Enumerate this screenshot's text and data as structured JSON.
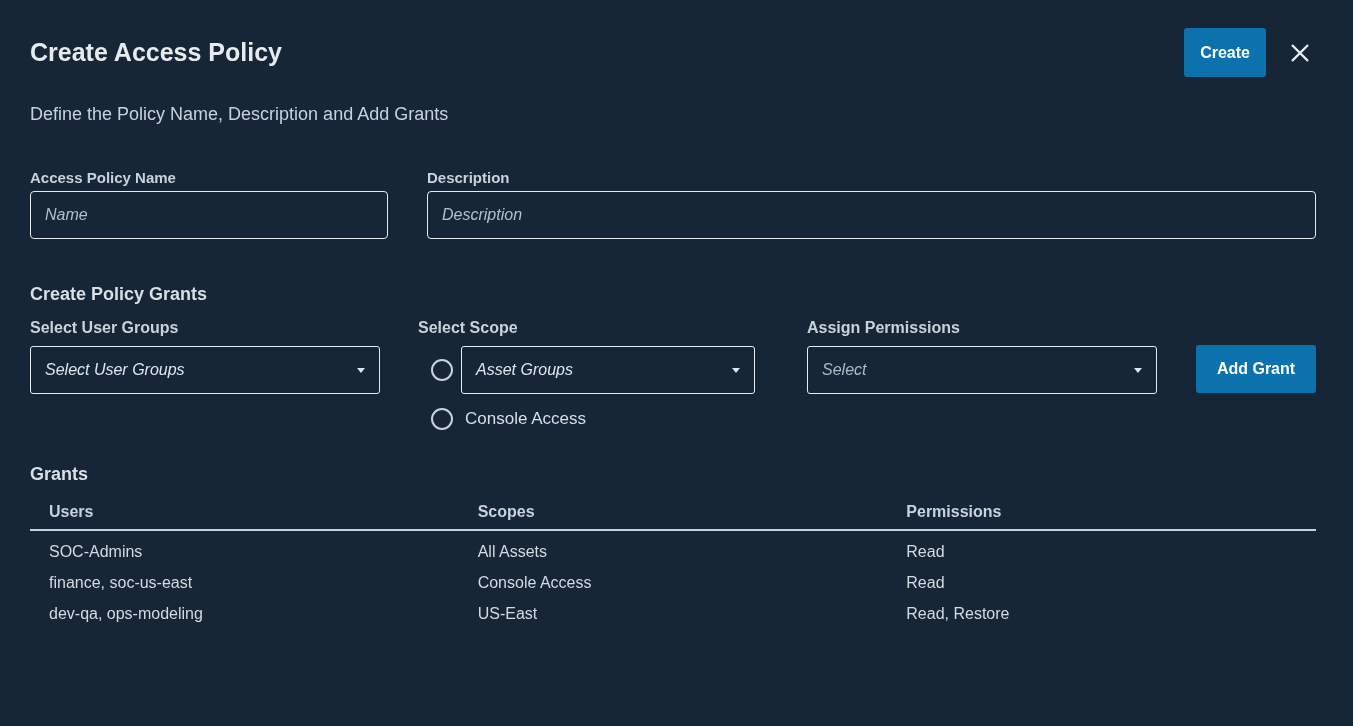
{
  "dialog": {
    "title": "Create Access Policy",
    "create_button": "Create",
    "subtitle": "Define the Policy Name, Description and Add Grants"
  },
  "fields": [
    {
      "label": "Access Policy Name",
      "placeholder": "Name"
    },
    {
      "label": "Description",
      "placeholder": "Description"
    }
  ],
  "grant_form": {
    "heading": "Create Policy Grants",
    "user_groups": {
      "label": "Select User Groups",
      "placeholder": "Select User Groups"
    },
    "scope": {
      "label": "Select Scope",
      "options": [
        {
          "kind": "dropdown",
          "text": "Asset Groups",
          "selected": false
        },
        {
          "kind": "label",
          "text": "Console Access",
          "selected": false
        }
      ]
    },
    "permissions": {
      "label": "Assign Permissions",
      "placeholder": "Select"
    },
    "add_button": "Add Grant"
  },
  "grants": {
    "heading": "Grants",
    "columns": [
      "Users",
      "Scopes",
      "Permissions"
    ],
    "rows": [
      [
        "SOC-Admins",
        "All Assets",
        "Read"
      ],
      [
        "finance, soc-us-east",
        "Console Access",
        "Read"
      ],
      [
        "dev-qa, ops-modeling",
        "US-East",
        "Read, Restore"
      ]
    ]
  }
}
